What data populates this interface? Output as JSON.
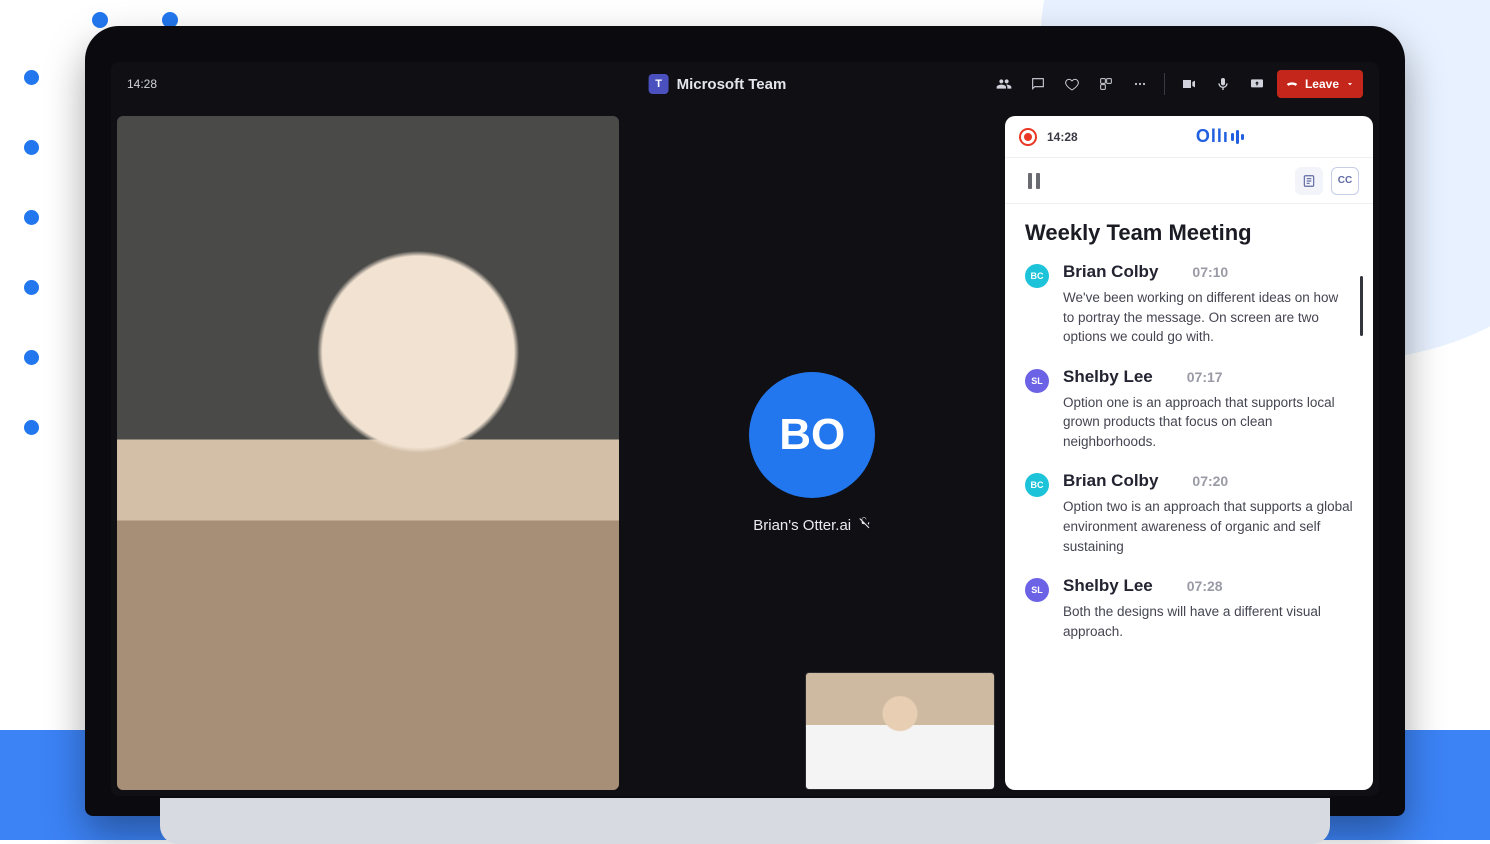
{
  "topbar": {
    "time": "14:28",
    "app_title": "Microsoft Team",
    "leave_label": "Leave"
  },
  "participant_tile": {
    "avatar_initials": "BO",
    "name": "Brian's Otter.ai"
  },
  "side_panel": {
    "rec_time": "14:28",
    "logo_text": "Ollı",
    "cc_label": "CC",
    "meeting_title": "Weekly Team Meeting",
    "entries": [
      {
        "initials": "BC",
        "avatar_class": "bc",
        "speaker": "Brian Colby",
        "time": "07:10",
        "text": "We've been working on different ideas on how to portray the message. On screen are two options we could go with."
      },
      {
        "initials": "SL",
        "avatar_class": "sl",
        "speaker": "Shelby Lee",
        "time": "07:17",
        "text": "Option one is an approach that supports local grown products that focus on clean neighborhoods."
      },
      {
        "initials": "BC",
        "avatar_class": "bc",
        "speaker": "Brian Colby",
        "time": "07:20",
        "text": "Option two is an approach that supports a global environment awareness of organic and self sustaining"
      },
      {
        "initials": "SL",
        "avatar_class": "sl",
        "speaker": "Shelby Lee",
        "time": "07:28",
        "text": "Both the designs will have a different visual approach."
      }
    ]
  }
}
